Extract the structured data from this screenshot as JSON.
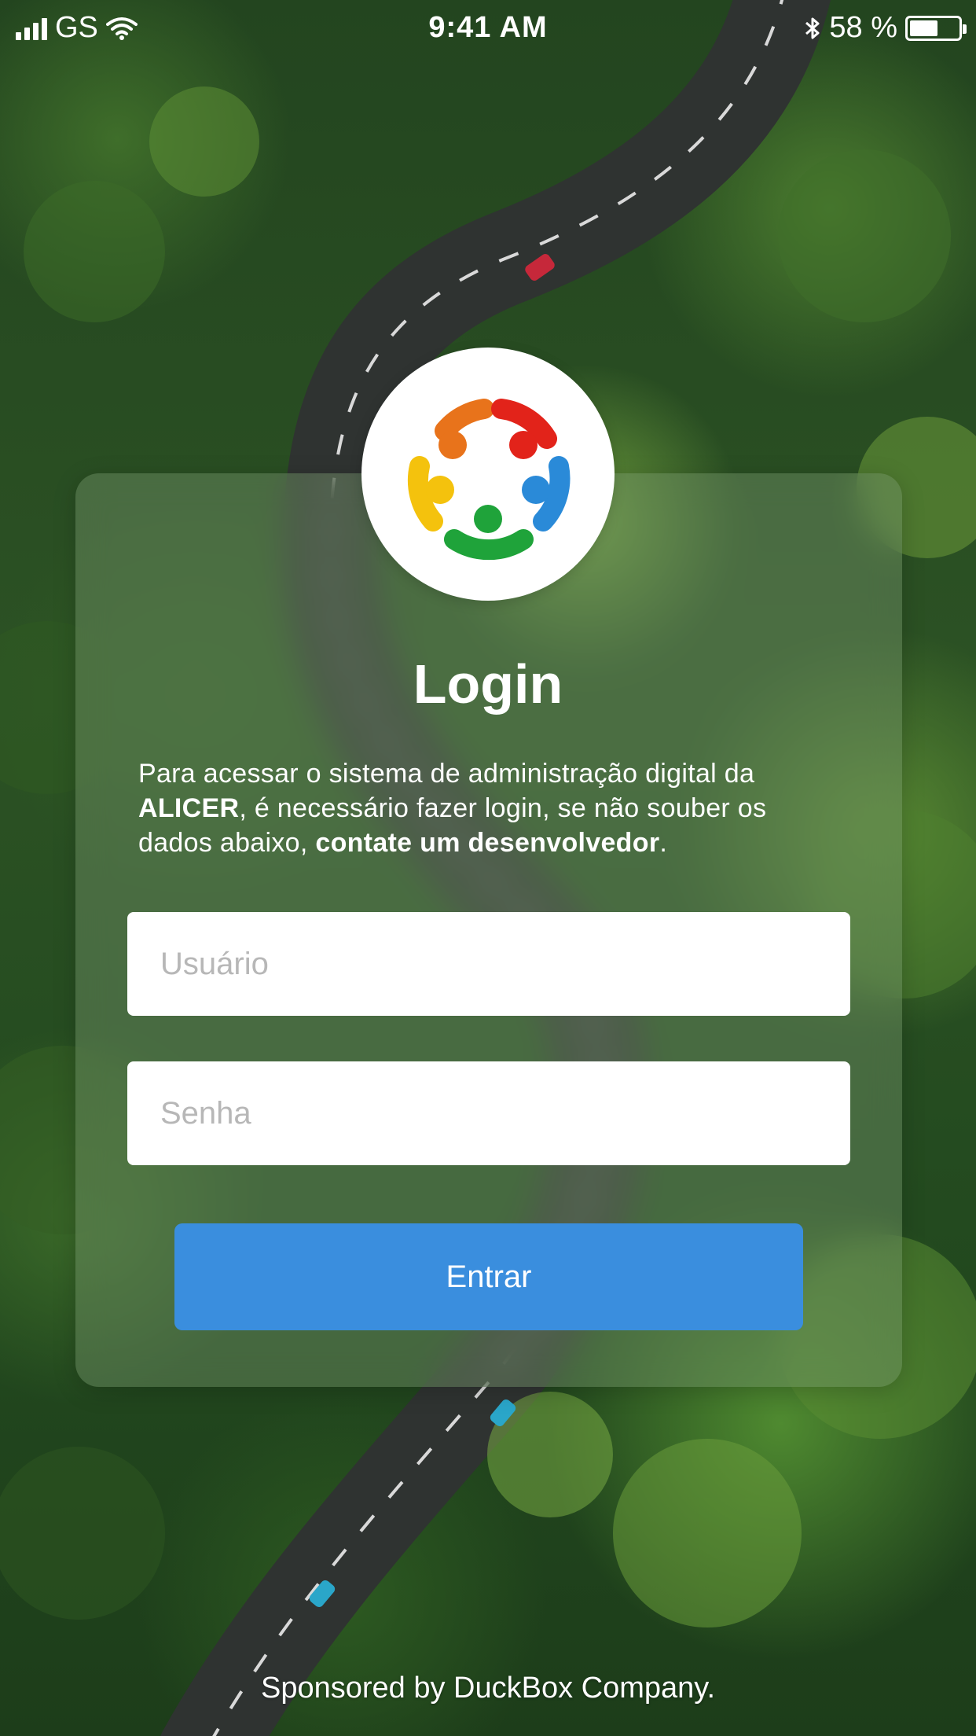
{
  "status_bar": {
    "carrier": "GS",
    "time": "9:41 AM",
    "battery_text": "58 %",
    "battery_level": 0.58
  },
  "login": {
    "title": "Login",
    "description_part1": "Para acessar o sistema de administração digital da ",
    "description_brand": "ALICER",
    "description_part2": ", é necessário fazer login, se não souber os dados abaixo, ",
    "description_contact": "contate um desenvolvedor",
    "description_part3": ".",
    "username_placeholder": "Usuário",
    "password_placeholder": "Senha",
    "submit_label": "Entrar"
  },
  "footer": {
    "text": "Sponsored by DuckBox Company."
  },
  "colors": {
    "button": "#3a8ede",
    "logo_orange": "#e8731b",
    "logo_red": "#e2231a",
    "logo_blue": "#2a8ad8",
    "logo_green": "#1fa33a",
    "logo_yellow": "#f4c20d"
  }
}
